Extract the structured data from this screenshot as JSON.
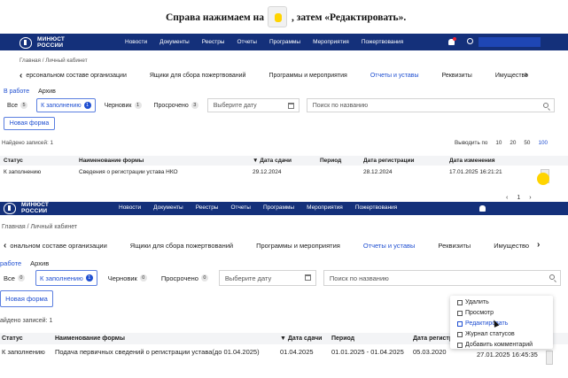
{
  "instruction": {
    "text_before": "Справа нажимаем на",
    "text_after": ", затем «Редактировать»."
  },
  "brand": {
    "line1": "МИНЮСТ",
    "line2": "РОССИИ"
  },
  "nav1": [
    "Новости",
    "Документы",
    "Реестры",
    "Отчеты",
    "Программы",
    "Мероприятия",
    "Пожертвования"
  ],
  "nav2": [
    "Новости",
    "Документы",
    "Реестры",
    "Отчеты",
    "Программы",
    "Мероприятия",
    "Пожертвования"
  ],
  "breadcrumb": "Главная / Личный кабинет",
  "tabs1": [
    "ерсональном составе организации",
    "Ящики для сбора пожертвований",
    "Программы и мероприятия",
    "Отчеты и уставы",
    "Реквизиты",
    "Имущество"
  ],
  "tabs2": [
    "ональном составе организации",
    "Ящики для сбора пожертвований",
    "Программы и мероприятия",
    "Отчеты и уставы",
    "Реквизиты",
    "Имущество"
  ],
  "subtabs1": [
    "В работе",
    "Архив"
  ],
  "subtabs2": [
    "работе",
    "Архив"
  ],
  "filters": [
    {
      "label": "Все",
      "count1": "5",
      "count2": "0"
    },
    {
      "label": "К заполнению",
      "count1": "1",
      "count2": "1"
    },
    {
      "label": "Черновик",
      "count1": "1",
      "count2": "0"
    },
    {
      "label": "Просрочено",
      "count1": "3",
      "count2": "0"
    }
  ],
  "date_placeholder": "Выберите дату",
  "search_placeholder": "Поиск по названию",
  "new_form": "Новая форма",
  "found1": "Найдено записей: 1",
  "found2": "айдено записей: 1",
  "pager": {
    "label": "Выводить по",
    "options": [
      "10",
      "20",
      "50",
      "100"
    ]
  },
  "pagination": {
    "prev": "‹",
    "page": "1",
    "next": "›"
  },
  "table1": {
    "headers": [
      "Статус",
      "Наименование формы",
      "▼ Дата сдачи",
      "Период",
      "Дата регистрации",
      "Дата изменения"
    ],
    "row": [
      "К заполнению",
      "Сведения о регистрации устава НКО",
      "29.12.2024",
      "",
      "28.12.2024",
      "17.01.2025 16:21:21"
    ]
  },
  "table2": {
    "headers": [
      "Статус",
      "Наименование формы",
      "▼ Дата сдачи",
      "Период",
      "Дата регистр"
    ],
    "row": [
      "К заполнению",
      "Подача первичных сведений о регистрации устава(до 01.04.2025)",
      "01.04.2025",
      "01.01.2025 - 01.04.2025",
      "05.03.2020",
      "27.01.2025 16:45:35"
    ]
  },
  "context_menu": [
    "Удалить",
    "Просмотр",
    "Редактировать",
    "Журнал статусов",
    "Добавить комментарий"
  ],
  "colors": {
    "nav": "#14307a",
    "accent": "#1f4fd1",
    "highlight": "#ffd400"
  }
}
